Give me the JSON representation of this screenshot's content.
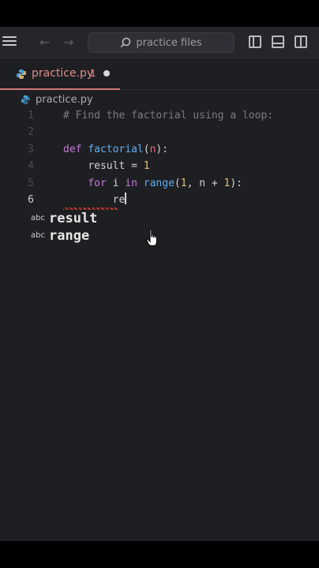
{
  "titlebar": {
    "search_text": "practice files"
  },
  "tab": {
    "label": "practice.py",
    "problem_count": "1"
  },
  "breadcrumb": {
    "file": "practice.py"
  },
  "editor": {
    "lines": [
      {
        "number": "1",
        "text": "# Find the factorial using a loop:"
      },
      {
        "number": "2",
        "text": ""
      },
      {
        "number": "3",
        "text": "def factorial(n):"
      },
      {
        "number": "4",
        "text": "    result = 1"
      },
      {
        "number": "5",
        "text": "    for i in range(1, n + 1):"
      },
      {
        "number": "6",
        "text": "        re"
      }
    ],
    "tokens": {
      "def": "def",
      "factorial": "factorial",
      "paren_open": "(",
      "n": "n",
      "paren_close_colon": "):",
      "result": "result",
      "eq": " = ",
      "one": "1",
      "for": "for",
      "i_in": " i ",
      "in": "in",
      "range": "range",
      "range_args_open": "(",
      "range_one": "1",
      "range_rest": ", n + ",
      "range_one_b": "1",
      "range_close": "):",
      "typed": "re"
    }
  },
  "suggestions": [
    {
      "kind": "abc",
      "label": "result"
    },
    {
      "kind": "abc",
      "label": "range"
    }
  ],
  "colors": {
    "accent_tab": "#e08b8b",
    "keyword": "#c678dd",
    "function": "#61afef",
    "number": "#e5c07b"
  }
}
